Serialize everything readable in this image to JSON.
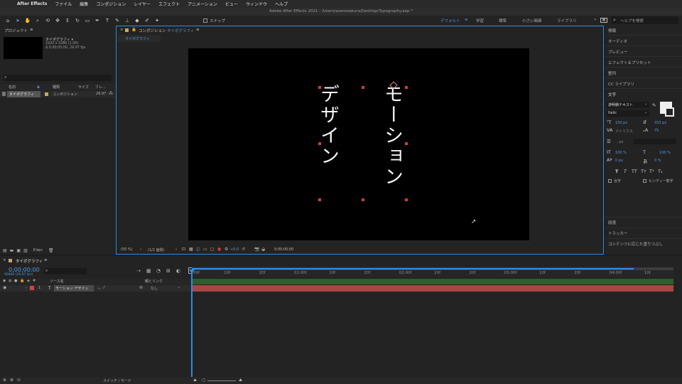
{
  "menubar": {
    "app": "After Effects",
    "items": [
      "ファイル",
      "編集",
      "コンポジション",
      "レイヤー",
      "エフェクト",
      "アニメーション",
      "ビュー",
      "ウィンドウ",
      "ヘルプ"
    ]
  },
  "window": {
    "title": "Adobe After Effects 2021 - /Users/asanosakura/Desktop/Typography.aep *"
  },
  "toolbar": {
    "snap_label": "スナップ"
  },
  "workspaces": {
    "items": [
      "デフォルト",
      "学習",
      "標準",
      "小さい画面",
      "ライブラリ"
    ],
    "search_placeholder": "ヘルプを検索"
  },
  "project": {
    "title": "プロジェクト",
    "item_name": "タイポグラフィ ▾",
    "item_res": "1920 x 1080 (1.00)",
    "item_dur": "Δ 0;00;05;00, 29.97 fps",
    "columns": [
      "名前",
      "種類",
      "サイズ",
      "フレ..."
    ],
    "row": {
      "name": "タイポグラフィ",
      "type": "コンポジション",
      "fps": "29.97"
    },
    "bpc": "8 bpc"
  },
  "comp": {
    "title": "コンポジション",
    "name": "タイポグラフィ",
    "tab": "タイポグラフィ",
    "text_right": "モーション",
    "text_left": "デザイン",
    "zoom": "(50 %)",
    "resolution": "(1/2 画質)",
    "exposure": "+0.0",
    "time": "0;00;00;00"
  },
  "right_panel": {
    "items": [
      "情報",
      "オーディオ",
      "プレビュー",
      "エフェクト＆プリセット",
      "整列",
      "CC ライブラリ"
    ],
    "char_title": "文字",
    "font": "游明朝テキスト",
    "style": "Italic",
    "font_size": "150 px",
    "leading": "333 px",
    "kerning": "メトリクス",
    "tracking": "75",
    "stroke": "- px",
    "vscale": "100 %",
    "hscale": "100 %",
    "baseline": "0 px",
    "tsume": "0 %",
    "cb_ligature": "合字",
    "cb_hindi": "ヒンディー数字",
    "bottom": [
      "段落",
      "トラッカー",
      "コンテンツに応じた塗りつぶし"
    ]
  },
  "timeline": {
    "tab": "タイポグラフィ",
    "time": "0;00;00;00",
    "time_sub": "00000 (29.97 fps)",
    "ticks": [
      "00f",
      "10f",
      "20f",
      "01:00f",
      "10f",
      "20f",
      "02:00f",
      "10f",
      "20f",
      "03:00f",
      "10f",
      "20f",
      "04:00f",
      "10f"
    ],
    "col_source": "ソース名",
    "col_parent": "親とリンク",
    "layer_num": "1",
    "layer_name": "モーション デザイン",
    "parent_value": "なし",
    "switch_mode": "スイッチ / モード"
  },
  "colors": {
    "accent": "#2d8ceb",
    "bg": "#1d1d1d",
    "panel": "#232323",
    "layer_bar": "#a94545"
  }
}
